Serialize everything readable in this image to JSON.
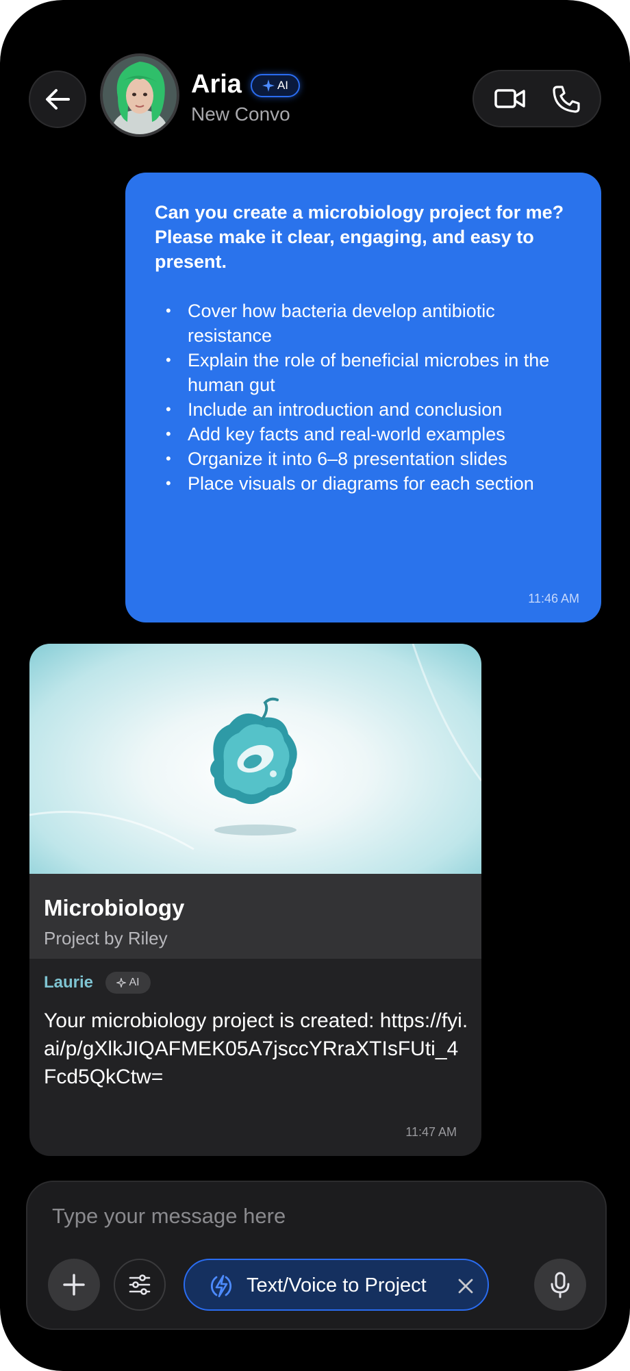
{
  "header": {
    "contact_name": "Aria",
    "ai_badge": "AI",
    "subtitle": "New Convo",
    "icons": [
      "back-arrow-icon",
      "video-camera-icon",
      "phone-icon"
    ]
  },
  "outgoing": {
    "intro": "Can you create a microbiology project for me? Please make it clear, engaging, and easy to present.",
    "items": [
      "Cover how bacteria develop antibiotic resistance",
      "Explain the role of beneficial microbes in the human gut",
      "Include an introduction and conclusion",
      "Add key facts and real-world examples",
      "Organize it into 6–8 presentation slides",
      "Place visuals or diagrams for each section"
    ],
    "time": "11:46 AM"
  },
  "card": {
    "title": "Microbiology",
    "subtitle": "Project by Riley",
    "sender": "Laurie",
    "ai_badge": "AI",
    "message": "Your microbiology project is created: https://fyi.ai/p/gXlkJIQAFMEK05A7jsccYRraXTIsFUti_4Fcd5QkCtw=",
    "time": "11:47 AM"
  },
  "composer": {
    "placeholder": "Type your message here",
    "mode_label": "Text/Voice to Project",
    "icons": [
      "plus-icon",
      "sliders-icon",
      "bolt-icon",
      "close-icon",
      "microphone-icon"
    ]
  },
  "colors": {
    "background": "#000000",
    "bubble_out": "#2a73ec",
    "card": "#222224",
    "accent": "#2a6cf0",
    "sender": "#7fc4d2"
  }
}
